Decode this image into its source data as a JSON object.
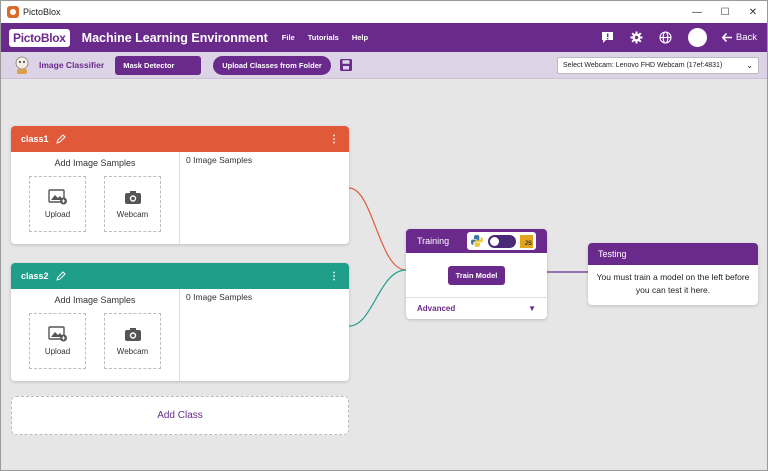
{
  "window": {
    "title": "PictoBlox",
    "controls": [
      "—",
      "☐",
      "✕"
    ]
  },
  "header": {
    "logo": "PictoBlox",
    "title": "Machine Learning Environment",
    "menu": [
      "File",
      "Tutorials",
      "Help"
    ],
    "back_label": "Back"
  },
  "toolbar": {
    "project_type": "Image Classifier",
    "mask_detector": "Mask Detector",
    "upload_classes": "Upload Classes from Folder",
    "webcam_label": "Select Webcam:",
    "webcam_value": "Lenovo FHD Webcam (17ef:4831)"
  },
  "classes": [
    {
      "name": "class1",
      "color": "#e05a3a",
      "add_samples": "Add Image Samples",
      "upload": "Upload",
      "webcam": "Webcam",
      "count": "0 Image Samples"
    },
    {
      "name": "class2",
      "color": "#1f9e89",
      "add_samples": "Add Image Samples",
      "upload": "Upload",
      "webcam": "Webcam",
      "count": "0 Image Samples"
    }
  ],
  "add_class": "Add Class",
  "training": {
    "title": "Training",
    "button": "Train Model",
    "advanced": "Advanced",
    "js_badge": "JS"
  },
  "testing": {
    "title": "Testing",
    "message": "You must train a model on the left before you can test it here."
  },
  "colors": {
    "brand": "#6a2a8c",
    "class1": "#e05a3a",
    "class2": "#1f9e89"
  }
}
